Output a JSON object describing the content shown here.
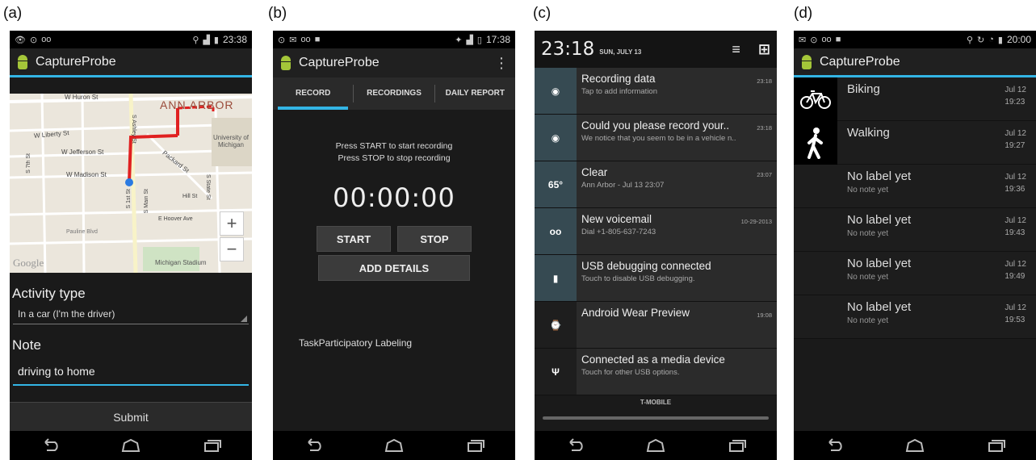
{
  "panels": {
    "a": {
      "label": "(a)",
      "status_time": "23:38",
      "app_title": "CaptureProbe",
      "map": {
        "streets": [
          "W Huron St",
          "ANN ARBOR",
          "W Liberty St",
          "W Jefferson St",
          "W Madison St",
          "S Ashley St",
          "S Main St",
          "Packard St",
          "S State St",
          "Hill St",
          "E Hoover Ave",
          "Pauline Blvd",
          "S 1st St",
          "S 7th St",
          "University of Michigan",
          "Michigan Stadium",
          "Google"
        ],
        "zoom_in": "+",
        "zoom_out": "−"
      },
      "activity_type_label": "Activity type",
      "activity_type_value": "In a car (I'm the driver)",
      "note_label": "Note",
      "note_value": "driving to home",
      "submit_label": "Submit"
    },
    "b": {
      "label": "(b)",
      "status_time": "17:38",
      "app_title": "CaptureProbe",
      "tabs": [
        "RECORD",
        "RECORDINGS",
        "DAILY REPORT"
      ],
      "instruction_1": "Press START to start recording",
      "instruction_2": "Press STOP to stop recording",
      "timer": "00:00:00",
      "start_label": "START",
      "stop_label": "STOP",
      "add_details_label": "ADD DETAILS",
      "task_label": "TaskParticipatory Labeling"
    },
    "c": {
      "label": "(c)",
      "time": "23:18",
      "date": "SUN, JULY 13",
      "notifications": [
        {
          "icon": "eye-icon",
          "title": "Recording data",
          "subtitle": "Tap to add information",
          "time": "23:18"
        },
        {
          "icon": "eye-icon",
          "title": "Could you please record your..",
          "subtitle": "We notice that you seem to be in a vehicle n..",
          "time": "23:18"
        },
        {
          "icon": "weather-icon",
          "icon_text": "65°",
          "title": "Clear",
          "subtitle": "Ann Arbor - Jul 13  23:07",
          "time": "23:07"
        },
        {
          "icon": "voicemail-icon",
          "title": "New voicemail",
          "subtitle": "Dial +1-805-637-7243",
          "time": "10-29-2013"
        },
        {
          "icon": "usb-debug-icon",
          "title": "USB debugging connected",
          "subtitle": "Touch to disable USB debugging.",
          "time": ""
        },
        {
          "icon": "watch-icon",
          "title": "Android Wear Preview",
          "subtitle": "",
          "time": "19:08"
        },
        {
          "icon": "usb-icon",
          "title": "Connected as a media device",
          "subtitle": "Touch for other USB options.",
          "time": ""
        }
      ],
      "carrier": "T-MOBILE"
    },
    "d": {
      "label": "(d)",
      "status_time": "20:00",
      "app_title": "CaptureProbe",
      "activities": [
        {
          "icon": "bicycle-icon",
          "title": "Biking",
          "note": "",
          "date": "Jul 12",
          "time": "19:23"
        },
        {
          "icon": "walking-icon",
          "title": "Walking",
          "note": "",
          "date": "Jul 12",
          "time": "19:27"
        },
        {
          "icon": "",
          "title": "No label yet",
          "note": "No note yet",
          "date": "Jul 12",
          "time": "19:36"
        },
        {
          "icon": "",
          "title": "No label yet",
          "note": "No note yet",
          "date": "Jul 12",
          "time": "19:43"
        },
        {
          "icon": "",
          "title": "No label yet",
          "note": "No note yet",
          "date": "Jul 12",
          "time": "19:49"
        },
        {
          "icon": "",
          "title": "No label yet",
          "note": "No note yet",
          "date": "Jul 12",
          "time": "19:53"
        }
      ]
    }
  },
  "colors": {
    "accent": "#33b5e5",
    "route": "#e02020",
    "android_green": "#a4c639"
  }
}
